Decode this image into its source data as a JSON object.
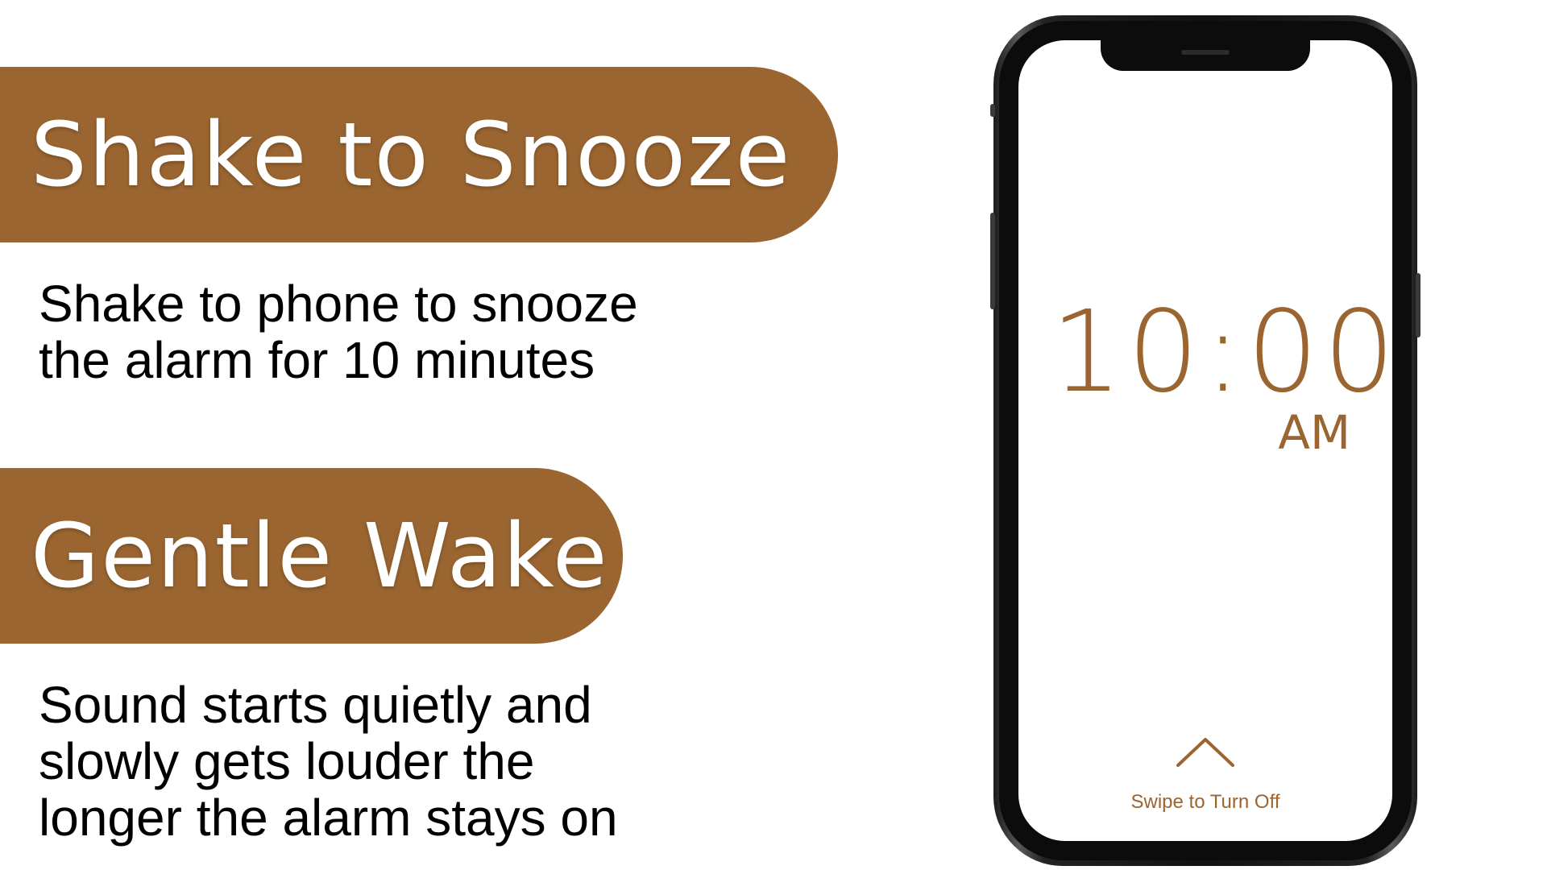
{
  "features": [
    {
      "title": "Shake to Snooze",
      "description_lines": [
        "Shake to phone to snooze",
        "the alarm for 10 minutes"
      ]
    },
    {
      "title": "Gentle Wake",
      "description_lines": [
        "Sound starts quietly and",
        "slowly gets louder the",
        "longer the alarm stays on"
      ]
    }
  ],
  "phone": {
    "time": "10:00",
    "meridiem": "AM",
    "swipe_label": "Swipe to Turn Off",
    "swipe_icon": "chevron-up-icon"
  },
  "colors": {
    "accent": "#9a6530",
    "banner_text": "#ffffff",
    "body_text": "#000000"
  }
}
